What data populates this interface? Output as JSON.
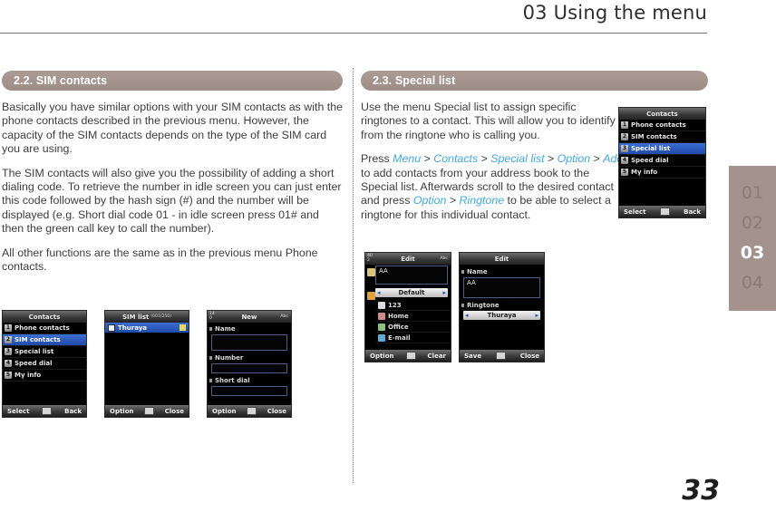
{
  "header": {
    "title": "03 Using the menu"
  },
  "side_tabs": {
    "items": [
      {
        "label": "01",
        "active": false
      },
      {
        "label": "02",
        "active": false
      },
      {
        "label": "03",
        "active": true
      },
      {
        "label": "04",
        "active": false
      }
    ]
  },
  "page_number": "33",
  "left_column": {
    "section_title": "2.2. SIM contacts",
    "paragraphs": [
      "Basically you have similar options with your SIM contacts as with the phone contacts described in the previous menu. However, the capacity of the SIM contacts depends on the type of the SIM card you are using.",
      "The SIM contacts will also give you the possibility of adding a short dialing code. To retrieve the number in idle screen you can just enter this code followed by the hash sign (#) and the number will be displayed (e.g. Short dial code 01 - in idle screen press 01# and then the green call key to call the number).",
      "All other functions are the same as in the previous menu Phone contacts."
    ],
    "screens": [
      {
        "name": "contacts-menu",
        "title": "Contacts",
        "items": [
          {
            "num": "1",
            "label": "Phone contacts",
            "selected": false
          },
          {
            "num": "2",
            "label": "SIM contacts",
            "selected": true
          },
          {
            "num": "3",
            "label": "Special list",
            "selected": false
          },
          {
            "num": "4",
            "label": "Speed dial",
            "selected": false
          },
          {
            "num": "5",
            "label": "My info",
            "selected": false
          }
        ],
        "softkeys": {
          "left": "Select",
          "right": "Back"
        }
      },
      {
        "name": "sim-list",
        "title": "SIM list",
        "title_sub": "(001/250)",
        "entry": "Thuraya",
        "softkeys": {
          "left": "Option",
          "right": "Close"
        }
      },
      {
        "name": "new-sim-contact",
        "title": "New",
        "corner_left": "14",
        "corner_left2": "0",
        "corner_right": "Abc",
        "fields": [
          {
            "label": "Name",
            "value": ""
          },
          {
            "label": "Number",
            "value": ""
          },
          {
            "label": "Short dial",
            "value": ""
          }
        ],
        "softkeys": {
          "left": "Option",
          "right": "Close"
        }
      }
    ]
  },
  "right_column": {
    "section_title": "2.3. Special list",
    "paragraph_1": "Use the menu Special list to assign specific ringtones to a contact. This will allow you to identify from the ringtone who is calling you.",
    "paragraph_2": {
      "prefix": "Press ",
      "tokens": [
        "Menu",
        "Contacts",
        "Special list",
        "Option",
        "Add"
      ],
      "mid_1": " to add contacts from your address book to the Special list. Afterwards scroll to the desired contact and press ",
      "tokens_2": [
        "Option",
        "Ringtone"
      ],
      "suffix": " to be able to select a ringtone for this individual contact.",
      "separator": " > "
    },
    "screens": [
      {
        "name": "contacts-menu-special",
        "title": "Contacts",
        "items": [
          {
            "num": "1",
            "label": "Phone contacts",
            "selected": false
          },
          {
            "num": "2",
            "label": "SIM contacts",
            "selected": false
          },
          {
            "num": "3",
            "label": "Special list",
            "selected": true
          },
          {
            "num": "4",
            "label": "Speed dial",
            "selected": false
          },
          {
            "num": "5",
            "label": "My info",
            "selected": false
          }
        ],
        "softkeys": {
          "left": "Select",
          "right": "Back"
        }
      },
      {
        "name": "edit-contact",
        "title": "Edit",
        "corner_left": "40",
        "corner_left2": "2",
        "corner_right": "Abc",
        "name_value": "AA",
        "group_value": "Default",
        "rows": [
          {
            "label": "123"
          },
          {
            "label": "Home"
          },
          {
            "label": "Office"
          },
          {
            "label": "E-mail"
          }
        ],
        "softkeys": {
          "left": "Option",
          "right": "Clear"
        }
      },
      {
        "name": "edit-ringtone",
        "title": "Edit",
        "field_name_label": "Name",
        "field_name_value": "AA",
        "field_ringtone_label": "Ringtone",
        "field_ringtone_value": "Thuraya",
        "softkeys": {
          "left": "Save",
          "right": "Close"
        }
      }
    ]
  },
  "colors": {
    "accent_bar": "#a3938c",
    "link_blue": "#3fa9e8",
    "text": "#3d3d3d",
    "selection_blue": "#2a55b4"
  }
}
